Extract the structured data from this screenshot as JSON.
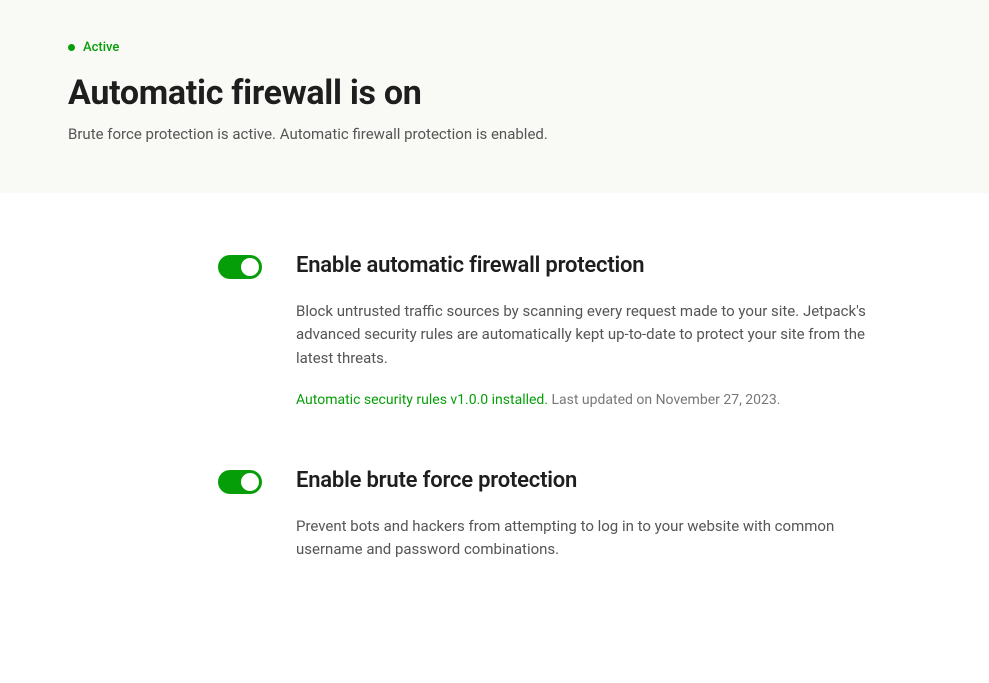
{
  "header": {
    "status_label": "Active",
    "title": "Automatic firewall is on",
    "subtitle": "Brute force protection is active. Automatic firewall protection is enabled."
  },
  "settings": {
    "firewall": {
      "title": "Enable automatic firewall protection",
      "description": "Block untrusted traffic sources by scanning every request made to your site. Jetpack's advanced security rules are automatically kept up-to-date to protect your site from the latest threats.",
      "rules_status": "Automatic security rules v1.0.0 installed.",
      "rules_updated": " Last updated on November 27, 2023."
    },
    "bruteforce": {
      "title": "Enable brute force protection",
      "description": "Prevent bots and hackers from attempting to log in to your website with common username and password combinations."
    }
  }
}
